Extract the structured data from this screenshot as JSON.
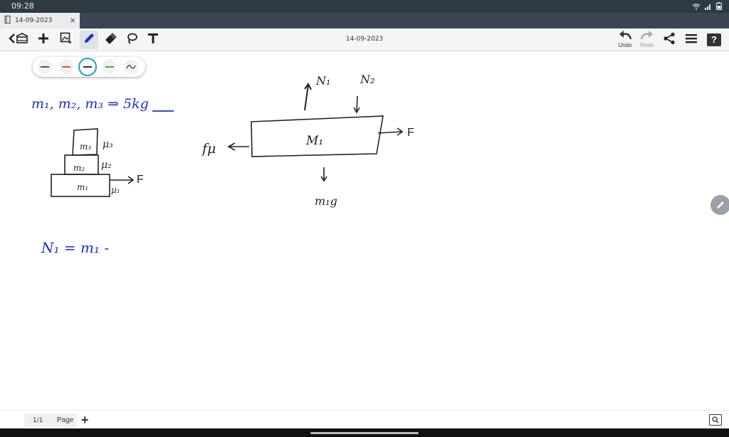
{
  "status_bar": {
    "time": "09:28"
  },
  "tab": {
    "title": "14-09-2023",
    "close": "×"
  },
  "toolbar": {
    "doc_title": "14-09-2023",
    "undo_label": "Undo",
    "redo_label": "Redo",
    "help": "?"
  },
  "pens": [
    {
      "color": "#555555"
    },
    {
      "color": "#d9534f"
    },
    {
      "color": "#333333",
      "selected": true
    },
    {
      "color": "#3cae4b"
    },
    {
      "color": "#333333"
    }
  ],
  "notes": {
    "line1": "m₁, m₂, m₃  ⇒  5kg",
    "stack_labels": [
      "m₃",
      "m₂",
      "m₁"
    ],
    "stack_mu": [
      "μ₃",
      "μ₂",
      "μ₁"
    ],
    "force": "F",
    "fbd_block": "M₁",
    "fbd_n1": "N₁",
    "fbd_n2": "N₂",
    "fbd_weight": "m₁g",
    "fbd_friction": "fμ",
    "fbd_force": "F",
    "equation": "N₁ = m₁ -"
  },
  "bottom_bar": {
    "page_number": "1/1",
    "page_label": "Page",
    "add": "+"
  },
  "colors": {
    "ink_blue": "#1a2fd0",
    "ink_dark": "#222222",
    "accent": "#1e9fd0"
  }
}
